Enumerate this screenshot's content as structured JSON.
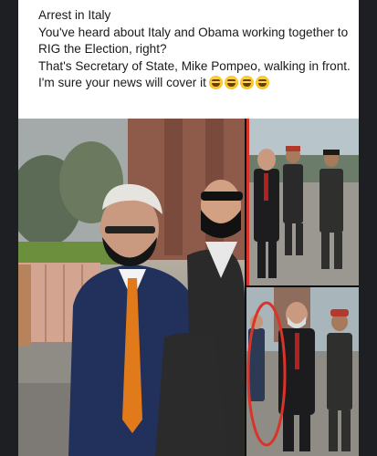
{
  "post": {
    "lines": [
      "Arrest in Italy",
      "You've heard about Italy and Obama working together to RIG the Election, right?",
      "That's Secretary of State, Mike Pompeo, walking in front.",
      "I'm sure your news will cover it"
    ],
    "emoji_count": 4,
    "emoji_icon": "laughing-face-emoji"
  },
  "photos": {
    "main_description_icon": "photo-man-in-mask-blue-suit",
    "top_right_icon": "photo-group-walking",
    "bottom_right_icon": "photo-man-circled-red"
  },
  "colors": {
    "highlight_circle": "#d9342b",
    "tie_orange": "#e07a1b",
    "suit_navy": "#1f2d55"
  }
}
